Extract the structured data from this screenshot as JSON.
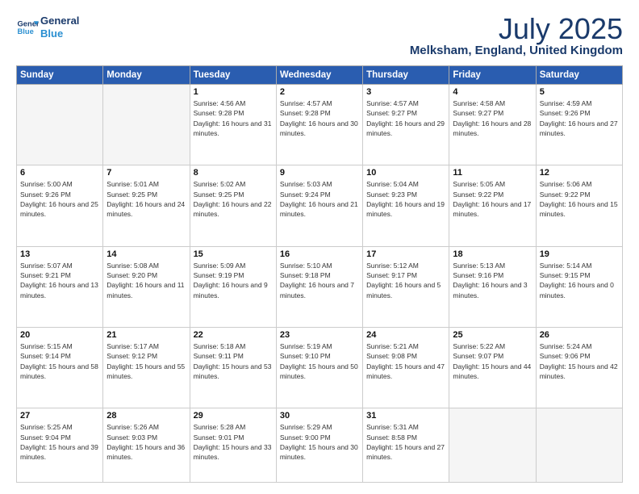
{
  "header": {
    "logo_line1": "General",
    "logo_line2": "Blue",
    "month_year": "July 2025",
    "location": "Melksham, England, United Kingdom"
  },
  "days_of_week": [
    "Sunday",
    "Monday",
    "Tuesday",
    "Wednesday",
    "Thursday",
    "Friday",
    "Saturday"
  ],
  "weeks": [
    [
      {
        "day": null
      },
      {
        "day": null
      },
      {
        "day": "1",
        "sunrise": "Sunrise: 4:56 AM",
        "sunset": "Sunset: 9:28 PM",
        "daylight": "Daylight: 16 hours and 31 minutes."
      },
      {
        "day": "2",
        "sunrise": "Sunrise: 4:57 AM",
        "sunset": "Sunset: 9:28 PM",
        "daylight": "Daylight: 16 hours and 30 minutes."
      },
      {
        "day": "3",
        "sunrise": "Sunrise: 4:57 AM",
        "sunset": "Sunset: 9:27 PM",
        "daylight": "Daylight: 16 hours and 29 minutes."
      },
      {
        "day": "4",
        "sunrise": "Sunrise: 4:58 AM",
        "sunset": "Sunset: 9:27 PM",
        "daylight": "Daylight: 16 hours and 28 minutes."
      },
      {
        "day": "5",
        "sunrise": "Sunrise: 4:59 AM",
        "sunset": "Sunset: 9:26 PM",
        "daylight": "Daylight: 16 hours and 27 minutes."
      }
    ],
    [
      {
        "day": "6",
        "sunrise": "Sunrise: 5:00 AM",
        "sunset": "Sunset: 9:26 PM",
        "daylight": "Daylight: 16 hours and 25 minutes."
      },
      {
        "day": "7",
        "sunrise": "Sunrise: 5:01 AM",
        "sunset": "Sunset: 9:25 PM",
        "daylight": "Daylight: 16 hours and 24 minutes."
      },
      {
        "day": "8",
        "sunrise": "Sunrise: 5:02 AM",
        "sunset": "Sunset: 9:25 PM",
        "daylight": "Daylight: 16 hours and 22 minutes."
      },
      {
        "day": "9",
        "sunrise": "Sunrise: 5:03 AM",
        "sunset": "Sunset: 9:24 PM",
        "daylight": "Daylight: 16 hours and 21 minutes."
      },
      {
        "day": "10",
        "sunrise": "Sunrise: 5:04 AM",
        "sunset": "Sunset: 9:23 PM",
        "daylight": "Daylight: 16 hours and 19 minutes."
      },
      {
        "day": "11",
        "sunrise": "Sunrise: 5:05 AM",
        "sunset": "Sunset: 9:22 PM",
        "daylight": "Daylight: 16 hours and 17 minutes."
      },
      {
        "day": "12",
        "sunrise": "Sunrise: 5:06 AM",
        "sunset": "Sunset: 9:22 PM",
        "daylight": "Daylight: 16 hours and 15 minutes."
      }
    ],
    [
      {
        "day": "13",
        "sunrise": "Sunrise: 5:07 AM",
        "sunset": "Sunset: 9:21 PM",
        "daylight": "Daylight: 16 hours and 13 minutes."
      },
      {
        "day": "14",
        "sunrise": "Sunrise: 5:08 AM",
        "sunset": "Sunset: 9:20 PM",
        "daylight": "Daylight: 16 hours and 11 minutes."
      },
      {
        "day": "15",
        "sunrise": "Sunrise: 5:09 AM",
        "sunset": "Sunset: 9:19 PM",
        "daylight": "Daylight: 16 hours and 9 minutes."
      },
      {
        "day": "16",
        "sunrise": "Sunrise: 5:10 AM",
        "sunset": "Sunset: 9:18 PM",
        "daylight": "Daylight: 16 hours and 7 minutes."
      },
      {
        "day": "17",
        "sunrise": "Sunrise: 5:12 AM",
        "sunset": "Sunset: 9:17 PM",
        "daylight": "Daylight: 16 hours and 5 minutes."
      },
      {
        "day": "18",
        "sunrise": "Sunrise: 5:13 AM",
        "sunset": "Sunset: 9:16 PM",
        "daylight": "Daylight: 16 hours and 3 minutes."
      },
      {
        "day": "19",
        "sunrise": "Sunrise: 5:14 AM",
        "sunset": "Sunset: 9:15 PM",
        "daylight": "Daylight: 16 hours and 0 minutes."
      }
    ],
    [
      {
        "day": "20",
        "sunrise": "Sunrise: 5:15 AM",
        "sunset": "Sunset: 9:14 PM",
        "daylight": "Daylight: 15 hours and 58 minutes."
      },
      {
        "day": "21",
        "sunrise": "Sunrise: 5:17 AM",
        "sunset": "Sunset: 9:12 PM",
        "daylight": "Daylight: 15 hours and 55 minutes."
      },
      {
        "day": "22",
        "sunrise": "Sunrise: 5:18 AM",
        "sunset": "Sunset: 9:11 PM",
        "daylight": "Daylight: 15 hours and 53 minutes."
      },
      {
        "day": "23",
        "sunrise": "Sunrise: 5:19 AM",
        "sunset": "Sunset: 9:10 PM",
        "daylight": "Daylight: 15 hours and 50 minutes."
      },
      {
        "day": "24",
        "sunrise": "Sunrise: 5:21 AM",
        "sunset": "Sunset: 9:08 PM",
        "daylight": "Daylight: 15 hours and 47 minutes."
      },
      {
        "day": "25",
        "sunrise": "Sunrise: 5:22 AM",
        "sunset": "Sunset: 9:07 PM",
        "daylight": "Daylight: 15 hours and 44 minutes."
      },
      {
        "day": "26",
        "sunrise": "Sunrise: 5:24 AM",
        "sunset": "Sunset: 9:06 PM",
        "daylight": "Daylight: 15 hours and 42 minutes."
      }
    ],
    [
      {
        "day": "27",
        "sunrise": "Sunrise: 5:25 AM",
        "sunset": "Sunset: 9:04 PM",
        "daylight": "Daylight: 15 hours and 39 minutes."
      },
      {
        "day": "28",
        "sunrise": "Sunrise: 5:26 AM",
        "sunset": "Sunset: 9:03 PM",
        "daylight": "Daylight: 15 hours and 36 minutes."
      },
      {
        "day": "29",
        "sunrise": "Sunrise: 5:28 AM",
        "sunset": "Sunset: 9:01 PM",
        "daylight": "Daylight: 15 hours and 33 minutes."
      },
      {
        "day": "30",
        "sunrise": "Sunrise: 5:29 AM",
        "sunset": "Sunset: 9:00 PM",
        "daylight": "Daylight: 15 hours and 30 minutes."
      },
      {
        "day": "31",
        "sunrise": "Sunrise: 5:31 AM",
        "sunset": "Sunset: 8:58 PM",
        "daylight": "Daylight: 15 hours and 27 minutes."
      },
      {
        "day": null
      },
      {
        "day": null
      }
    ]
  ]
}
